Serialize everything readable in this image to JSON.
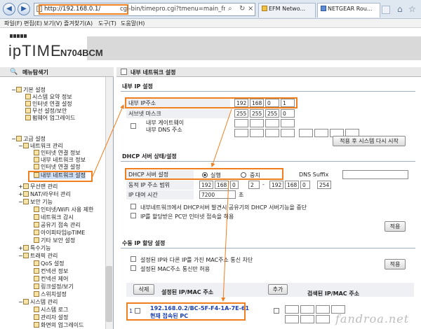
{
  "browser": {
    "url": "http://192.168.0.1/cgi-bin/timepro.cgi?tmenu=main_frame&smenu=m",
    "url_host": "http://192.168.0.1/",
    "url_path": "cgi-bin/timepro.cgi?tmenu=main_frame&smenu=m",
    "tabs": [
      "EFM Netwo...",
      "NETGEAR Rou..."
    ],
    "menu": [
      "파일(F)",
      "편집(E)",
      "보기(V)",
      "즐겨찾기(A)",
      "도구(T)",
      "도움말(H)"
    ]
  },
  "logo": {
    "brand": "ipTIME",
    "model": "N704BCM"
  },
  "left": {
    "title": "메뉴탐색기",
    "basic": {
      "label": "기본 설정",
      "items": [
        "시스템 요약 정보",
        "인터넷 연결 설정",
        "무선 설정/보안",
        "펌웨어 업그레이드"
      ]
    },
    "advanced": {
      "label": "고급 설정"
    },
    "network": {
      "label": "네트워크 관리",
      "items": [
        "인터넷 연결 정보",
        "내부 네트워크 정보",
        "인터넷 연결 설정",
        "내부 네트워크 설정"
      ]
    },
    "wireless": "무선랜 관리",
    "nat": "NAT/라우터 관리",
    "security": {
      "label": "보안 기능",
      "items": [
        "인터넷/WiFi 사용 제한",
        "네트워크 감시",
        "공유기 접속 관리",
        "아이피타임ipTIME",
        "기타 보안 설정"
      ]
    },
    "special": "특수기능",
    "traffic": {
      "label": "트래픽 관리",
      "items": [
        "QoS 설정",
        "컨넥션 정보",
        "컨넥션 제어",
        "링크설정/보기",
        "스위치설정"
      ]
    },
    "system": {
      "label": "시스템 관리",
      "items": [
        "시스템 로그",
        "관리자 설정",
        "화면의 업그레이드"
      ]
    }
  },
  "main": {
    "title": "내부 네트워크 설정",
    "ip_section": "내부 IP 설정",
    "ip_label": "내부 IP주소",
    "ip": [
      "192",
      "168",
      "0",
      "1"
    ],
    "subnet_label": "서브넷 마스크",
    "subnet": [
      "255",
      "255",
      "255",
      "0"
    ],
    "gateway_label": "내부 게이트웨이",
    "dns_label": "내부 DNS 주소",
    "apply_restart": "적용 후 시스템 다시 시작",
    "dhcp_section": "DHCP 서버 상태/설정",
    "dhcp_label": "DHCP 서버 설정",
    "dhcp_on": "실행",
    "dhcp_off": "중지",
    "dns_suffix_label": "DNS Suffix",
    "range_label": "동적 IP 주소 범위",
    "range_start": [
      "192",
      "168",
      "0",
      "2"
    ],
    "range_sep": "-",
    "range_end": [
      "192",
      "168",
      "0",
      "254"
    ],
    "lease_label": "IP 대여 시간",
    "lease_value": "7200",
    "lease_unit": "초",
    "opt1": "내부네트워크에서 DHCP서버 발견시 공유기의 DHCP 서버기능을 중단",
    "opt2": "IP를 할당받은 PC만 인터넷 접속을 허용",
    "apply": "적용",
    "manual_section": "수동 IP 할당 설정",
    "opt3": "설정된 IP와 다른 IP를 가진 MAC주소 통신 차단",
    "opt4": "설정된 MAC주소 통신만 허용",
    "apply2": "적용",
    "delete": "삭제",
    "assigned_header": "설정된 IP/MAC 주소",
    "add": "추가",
    "search_header": "검색된 IP/MAC 주소",
    "row_num": "1",
    "row_ipmac": "192.168.0.2/BC-5F-F4-1A-7E-61",
    "row_status": "현재 접속된 PC"
  },
  "watermark": "fandroa.net",
  "colors": {
    "highlight": "#f07f1f",
    "link_blue": "#1a3fb0"
  }
}
